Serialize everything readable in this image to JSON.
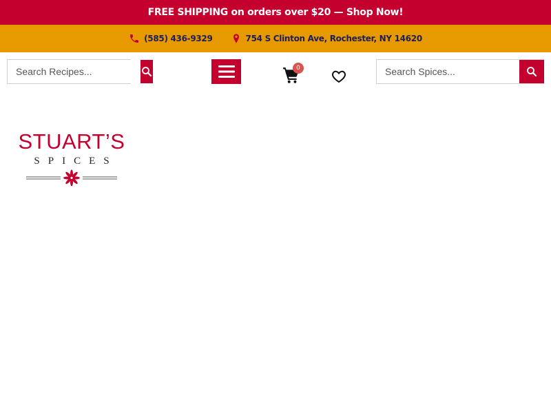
{
  "promo": {
    "text": "FREE SHIPPING on orders over $20 — Shop Now!"
  },
  "contact": {
    "phone": "(585) 436-9329",
    "address": "754 S Clinton Ave, Rochester, NY 14620",
    "phone_icon": "phone-icon",
    "address_icon": "map-pin-icon"
  },
  "search_recipes": {
    "placeholder": "Search Recipes..."
  },
  "search_spices": {
    "placeholder": "Search Spices..."
  },
  "cart": {
    "count": "0"
  },
  "logo": {
    "title": "STUART’S",
    "subtitle": "SPICES"
  },
  "colors": {
    "brand_red": "#c4002f",
    "accent_orange": "#e69a00",
    "contact_text": "#1e1e5c"
  }
}
